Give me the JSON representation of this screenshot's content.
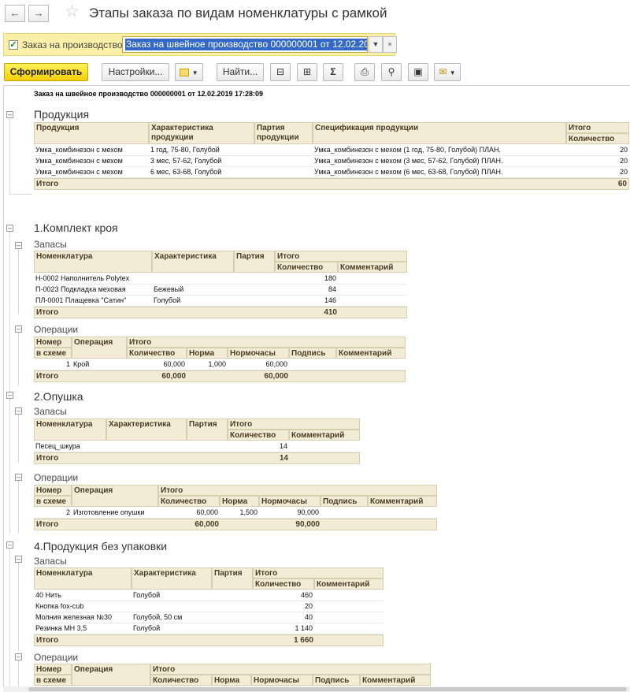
{
  "window": {
    "title": "Этапы заказа по видам номенклатуры с рамкой"
  },
  "params": {
    "label": "Заказ на производство:",
    "value": "Заказ на швейное производство 000000001 от 12.02.2019 17"
  },
  "toolbar": {
    "generate": "Сформировать",
    "settings": "Настройки...",
    "find": "Найти..."
  },
  "report": {
    "header": "Заказ на швейное производство 000000001 от 12.02.2019 17:28:09",
    "products": {
      "title": "Продукция",
      "cols": [
        "Продукция",
        "Характеристика продукции",
        "Партия продукции",
        "Спецификация продукции",
        "Итого",
        "Количество"
      ],
      "rows": [
        {
          "product": "Умка_комбинезон с мехом",
          "char": "1 год, 75-80, Голубой",
          "batch": "",
          "spec": "Умка_комбинезон с мехом (1 год, 75-80, Голубой) ПЛАН.",
          "qty": "20"
        },
        {
          "product": "Умка_комбинезон с мехом",
          "char": "3 мес, 57-62, Голубой",
          "batch": "",
          "spec": "Умка_комбинезон с мехом (3 мес, 57-62, Голубой) ПЛАН.",
          "qty": "20"
        },
        {
          "product": "Умка_комбинезон с мехом",
          "char": "6 мес, 63-68, Голубой",
          "batch": "",
          "spec": "Умка_комбинезон с мехом (6 мес, 63-68, Голубой) ПЛАН.",
          "qty": "20"
        }
      ],
      "total_label": "Итого",
      "total": "60"
    },
    "labels": {
      "stock": "Запасы",
      "ops": "Операции",
      "nom": "Номенклатура",
      "char": "Характеристика",
      "batch": "Партия",
      "total": "Итого",
      "qty": "Количество",
      "comment": "Комментарий",
      "num1": "Номер",
      "num2": "в схеме",
      "op": "Операция",
      "norm": "Норма",
      "hours": "Нормочасы",
      "sign": "Подпись"
    },
    "s1": {
      "title": "1.Комплект кроя",
      "stock": [
        {
          "nom": "Н-0002 Наполнитель Polytex",
          "char": "",
          "qty": "180"
        },
        {
          "nom": "П-0023 Подкладка меховая",
          "char": "Бежевый",
          "qty": "84"
        },
        {
          "nom": "ПЛ-0001 Плащевка \"Сатин\"",
          "char": "Голубой",
          "qty": "146"
        }
      ],
      "stock_total": "410",
      "ops": [
        {
          "num": "1",
          "op": "Крой",
          "qty": "60,000",
          "norm": "1,000",
          "hours": "60,000"
        }
      ],
      "ops_total_qty": "60,000",
      "ops_total_hours": "60,000"
    },
    "s2": {
      "title": "2.Опушка",
      "stock": [
        {
          "nom": "Песец_шкура",
          "char": "",
          "qty": "14"
        }
      ],
      "stock_total": "14",
      "ops": [
        {
          "num": "2",
          "op": "Изготовление опушки",
          "qty": "60,000",
          "norm": "1,500",
          "hours": "90,000"
        }
      ],
      "ops_total_qty": "60,000",
      "ops_total_hours": "90,000"
    },
    "s4": {
      "title": "4.Продукция без упаковки",
      "stock": [
        {
          "nom": "40 Нить",
          "char": "Голубой",
          "qty": "460"
        },
        {
          "nom": "Кнопка fox-cub",
          "char": "",
          "qty": "20"
        },
        {
          "nom": "Молния железная №30",
          "char": "Голубой, 50 см",
          "qty": "40"
        },
        {
          "nom": "Резинка МН 3,5",
          "char": "Голубой",
          "qty": "1 140"
        }
      ],
      "stock_total": "1 660"
    }
  },
  "colors": {
    "accent": "#f3cd0a",
    "header_bg": "#f2ecd6",
    "param_bg": "#fcf0a8"
  }
}
